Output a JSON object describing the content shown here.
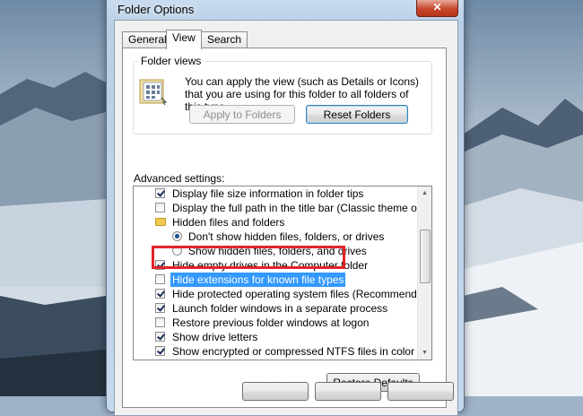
{
  "window": {
    "title": "Folder Options",
    "close_label": "✕"
  },
  "tabs": [
    {
      "label": "General",
      "active": false
    },
    {
      "label": "View",
      "active": true
    },
    {
      "label": "Search",
      "active": false
    }
  ],
  "folder_views": {
    "label": "Folder views",
    "description": "You can apply the view (such as Details or Icons) that you are using for this folder to all folders of this type.",
    "apply_button": "Apply to Folders",
    "reset_button": "Reset Folders"
  },
  "advanced": {
    "label": "Advanced settings:",
    "items": [
      {
        "type": "checkbox",
        "checked": true,
        "label": "Display file size information in folder tips"
      },
      {
        "type": "checkbox",
        "checked": false,
        "label": "Display the full path in the title bar (Classic theme only)"
      },
      {
        "type": "folder",
        "label": "Hidden files and folders"
      },
      {
        "type": "radio",
        "checked": true,
        "label": "Don't show hidden files, folders, or drives"
      },
      {
        "type": "radio",
        "checked": false,
        "label": "Show hidden files, folders, and drives"
      },
      {
        "type": "checkbox",
        "checked": true,
        "label": "Hide empty drives in the Computer folder"
      },
      {
        "type": "checkbox",
        "checked": false,
        "label": "Hide extensions for known file types",
        "selected": true
      },
      {
        "type": "checkbox",
        "checked": true,
        "label": "Hide protected operating system files (Recommended)"
      },
      {
        "type": "checkbox",
        "checked": true,
        "label": "Launch folder windows in a separate process"
      },
      {
        "type": "checkbox",
        "checked": false,
        "label": "Restore previous folder windows at logon"
      },
      {
        "type": "checkbox",
        "checked": true,
        "label": "Show drive letters"
      },
      {
        "type": "checkbox",
        "checked": true,
        "label": "Show encrypted or compressed NTFS files in color"
      }
    ],
    "restore_button": "Restore Defaults"
  },
  "colors": {
    "highlight_box": "#e3242b",
    "selection": "#3399ff"
  }
}
